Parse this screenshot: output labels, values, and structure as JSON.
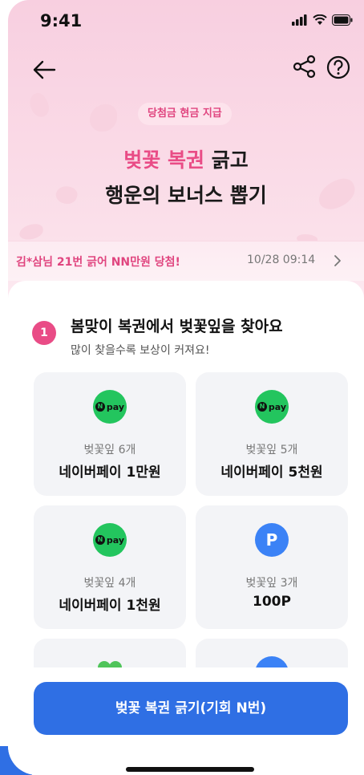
{
  "status": {
    "time": "9:41"
  },
  "nav": {
    "back_icon": "arrow-left-icon",
    "share_icon": "share-icon",
    "help_icon": "help-icon"
  },
  "hero": {
    "badge": "당첨금 현금 지급",
    "title_highlight": "벚꽃 복권",
    "title_rest": " 긁고",
    "title_line2": "행운의 보너스 뽑기"
  },
  "ticker": {
    "message": "김*삼님 21번 긁어 NN만원 당첨!",
    "timestamp": "10/28 09:14"
  },
  "step": {
    "number": "1",
    "title": "봄맞이 복권에서 벚꽃잎을 찾아요",
    "subtitle": "많이 찾을수록 보상이 커져요!"
  },
  "rewards": [
    {
      "icon": "npay-icon",
      "icon_text": "pay",
      "label": "벚꽃잎 6개",
      "value": "네이버페이 1만원"
    },
    {
      "icon": "npay-icon",
      "icon_text": "pay",
      "label": "벚꽃잎 5개",
      "value": "네이버페이 5천원"
    },
    {
      "icon": "npay-icon",
      "icon_text": "pay",
      "label": "벚꽃잎 4개",
      "value": "네이버페이 1천원"
    },
    {
      "icon": "point-icon",
      "icon_text": "P",
      "label": "벚꽃잎 3개",
      "value": "100P"
    }
  ],
  "cta": {
    "label": "벚꽃 복권 긁기(기회 N번)"
  },
  "colors": {
    "accent_pink": "#e94c86",
    "primary_blue": "#2f6fe4",
    "npay_green": "#23c55e"
  }
}
